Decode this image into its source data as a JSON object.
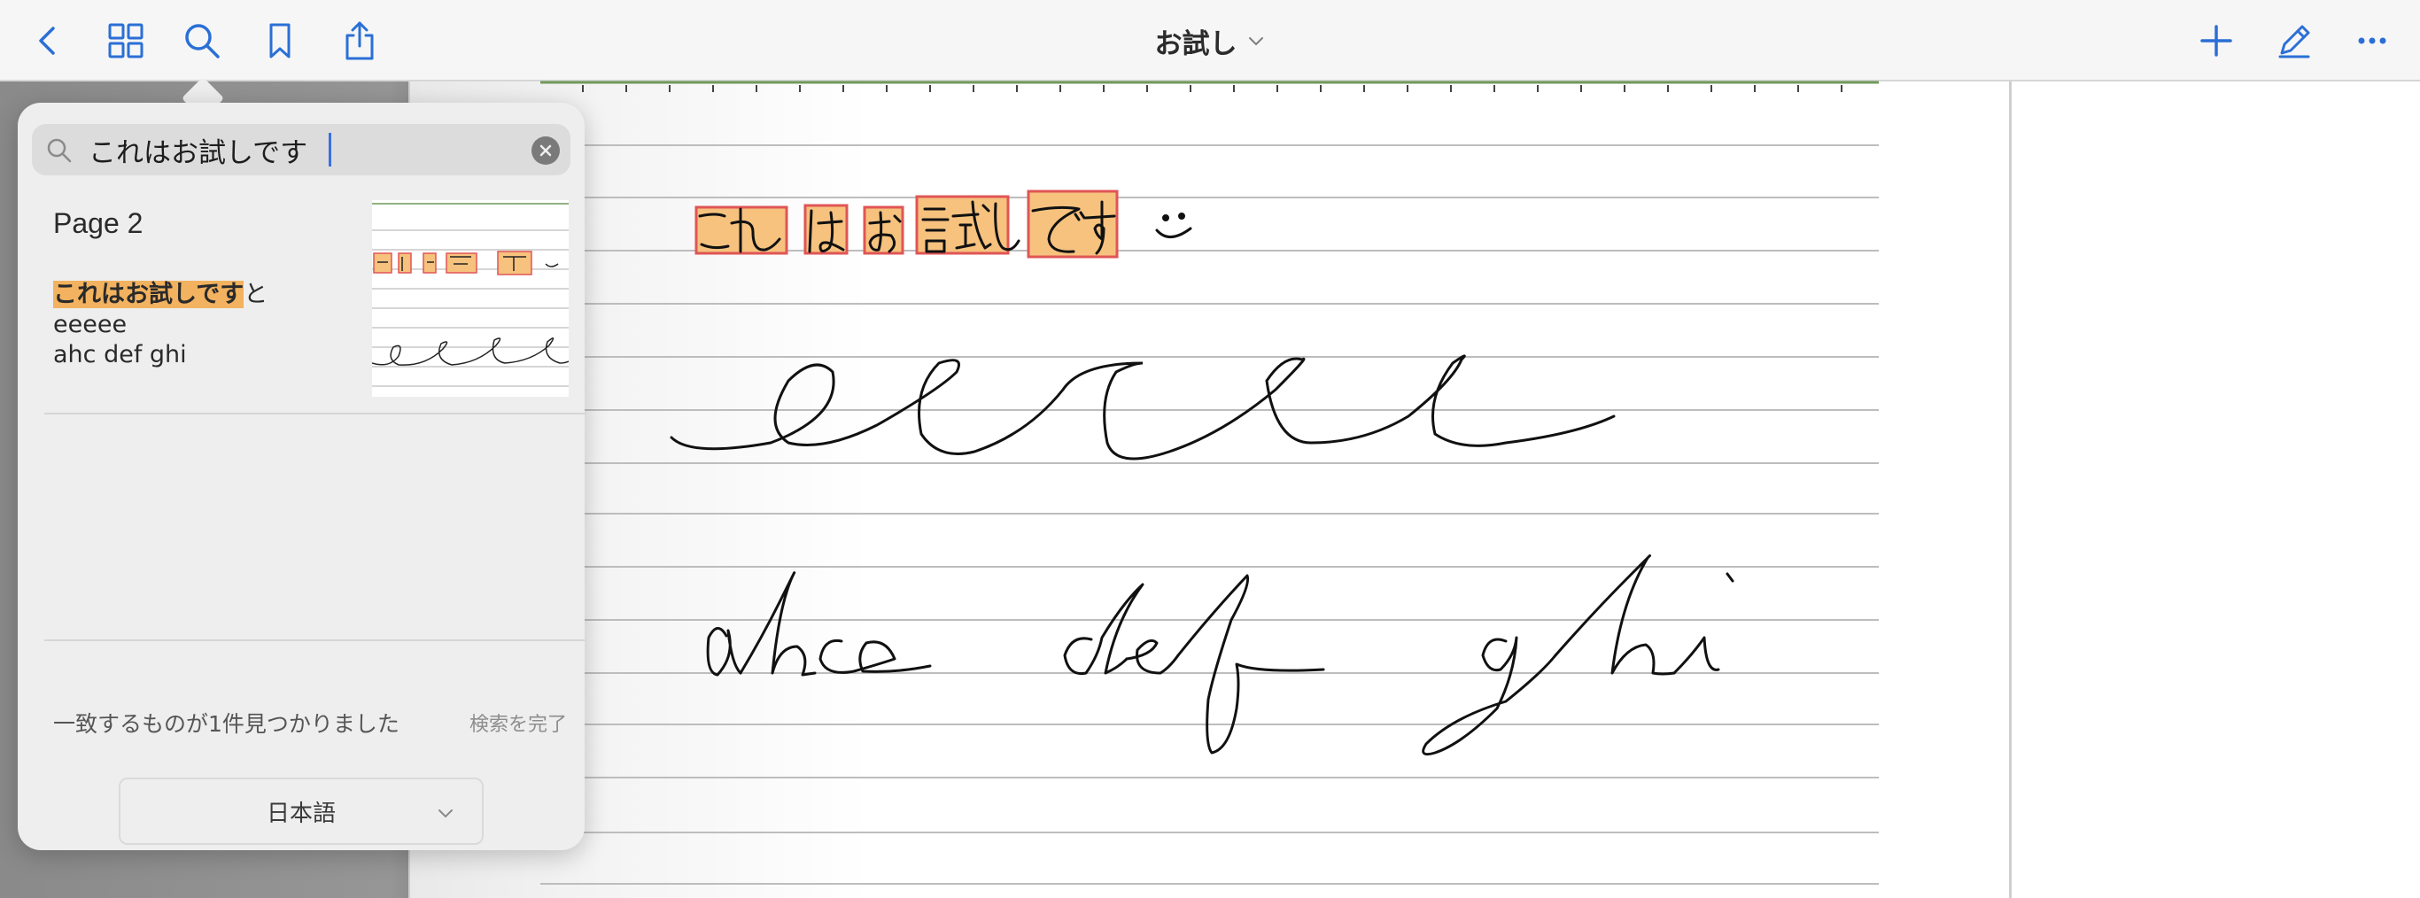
{
  "toolbar": {
    "title": "お試し",
    "icons": [
      "back-chevron-icon",
      "grid-icon",
      "search-icon",
      "bookmark-icon",
      "share-icon",
      "plus-icon",
      "pencil-icon",
      "more-icon"
    ],
    "accent": "#2b6fd6"
  },
  "search": {
    "query": "これはお試しです",
    "result": {
      "page_label": "Page 2",
      "snippet_highlight": "これはお試しです",
      "snippet_after": "と",
      "snippet_line2": "eeeee",
      "snippet_line3": "ahc def ghi"
    },
    "status": "一致するものが1件見つかりました",
    "done_label": "検索を完了",
    "language": "日本語"
  },
  "note": {
    "line1_chars": [
      "これ",
      "は",
      "お",
      "試し",
      "です"
    ],
    "smiley": ":)",
    "highlight_color": "#f6c27e"
  }
}
